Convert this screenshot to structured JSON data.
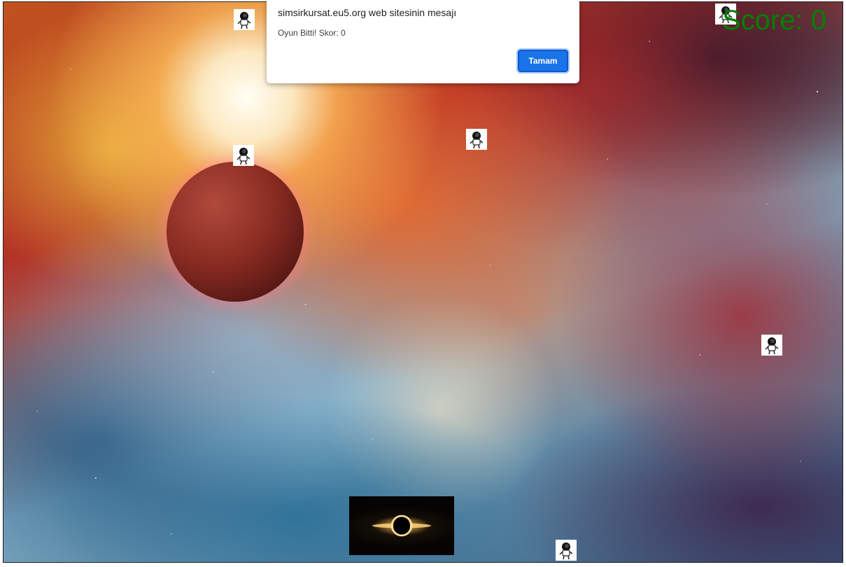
{
  "dialog": {
    "title": "simsirkursat.eu5.org web sitesinin mesajı",
    "message": "Oyun Bitti! Skor: 0",
    "ok_label": "Tamam",
    "ok_color": "#1a73e8"
  },
  "hud": {
    "score_text": "Score: 0",
    "score_color": "#008000"
  },
  "game": {
    "player_sprite": "black-hole-icon",
    "falling_sprite": "astronaut-icon",
    "falling_count": 6
  }
}
